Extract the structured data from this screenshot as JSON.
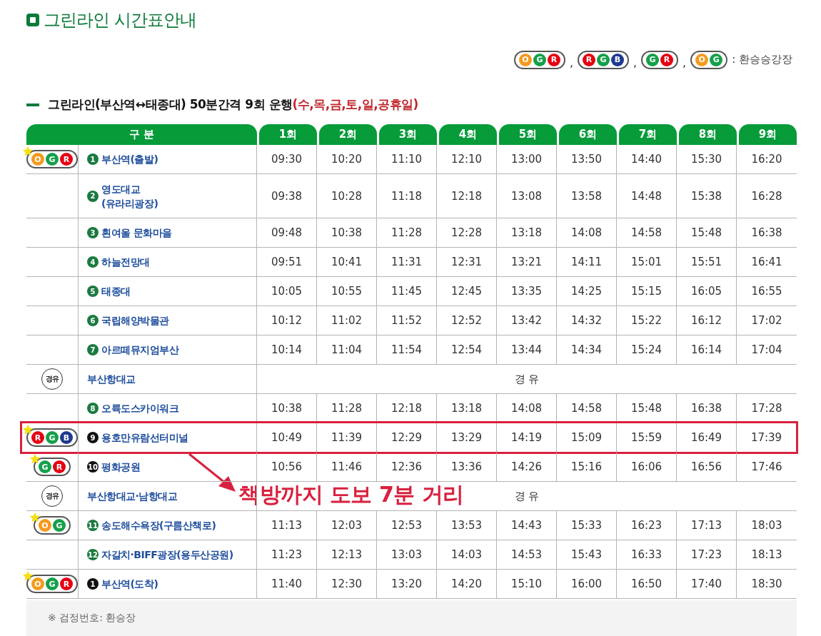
{
  "title": "그린라인 시간표안내",
  "legend": {
    "badges": [
      {
        "dots": [
          {
            "letter": "O",
            "color": "#f39a1e"
          },
          {
            "letter": "G",
            "color": "#14a04a"
          },
          {
            "letter": "R",
            "color": "#e60012"
          }
        ]
      },
      {
        "dots": [
          {
            "letter": "R",
            "color": "#e60012"
          },
          {
            "letter": "G",
            "color": "#14a04a"
          },
          {
            "letter": "B",
            "color": "#1f3a8f"
          }
        ]
      },
      {
        "dots": [
          {
            "letter": "G",
            "color": "#14a04a"
          },
          {
            "letter": "R",
            "color": "#e60012"
          }
        ]
      },
      {
        "dots": [
          {
            "letter": "O",
            "color": "#f39a1e"
          },
          {
            "letter": "G",
            "color": "#14a04a"
          }
        ]
      }
    ],
    "separators": [
      ",",
      ",",
      ","
    ],
    "label": ": 환승승강장"
  },
  "subtitle": {
    "text": "그린라인(부산역↔태종대) 50분간격 9회 운행",
    "days": "(수,목,금,토,일,공휴일)"
  },
  "table": {
    "columns": [
      "구 분",
      "1회",
      "2회",
      "3회",
      "4회",
      "5회",
      "6회",
      "7회",
      "8회",
      "9회"
    ],
    "rows": [
      {
        "kind": "stop",
        "number": "1",
        "color": "#1b7a40",
        "name": "부산역(출발)",
        "transfer": {
          "star": true,
          "dots": [
            {
              "letter": "O",
              "color": "#f39a1e"
            },
            {
              "letter": "G",
              "color": "#14a04a"
            },
            {
              "letter": "R",
              "color": "#e60012"
            }
          ]
        },
        "times": [
          "09:30",
          "10:20",
          "11:10",
          "12:10",
          "13:00",
          "13:50",
          "14:40",
          "15:30",
          "16:20"
        ]
      },
      {
        "kind": "stop",
        "number": "2",
        "color": "#1b7a40",
        "name": "영도대교\n(유라리광장)",
        "times": [
          "09:38",
          "10:28",
          "11:18",
          "12:18",
          "13:08",
          "13:58",
          "14:48",
          "15:38",
          "16:28"
        ]
      },
      {
        "kind": "stop",
        "number": "3",
        "color": "#1b7a40",
        "name": "흰여울 문화마을",
        "times": [
          "09:48",
          "10:38",
          "11:28",
          "12:28",
          "13:18",
          "14:08",
          "14:58",
          "15:48",
          "16:38"
        ]
      },
      {
        "kind": "stop",
        "number": "4",
        "color": "#1b7a40",
        "name": "하늘전망대",
        "times": [
          "09:51",
          "10:41",
          "11:31",
          "12:31",
          "13:21",
          "14:11",
          "15:01",
          "15:51",
          "16:41"
        ]
      },
      {
        "kind": "stop",
        "number": "5",
        "color": "#1b7a40",
        "name": "태종대",
        "times": [
          "10:05",
          "10:55",
          "11:45",
          "12:45",
          "13:35",
          "14:25",
          "15:15",
          "16:05",
          "16:55"
        ]
      },
      {
        "kind": "stop",
        "number": "6",
        "color": "#1b7a40",
        "name": "국립해양박물관",
        "times": [
          "10:12",
          "11:02",
          "11:52",
          "12:52",
          "13:42",
          "14:32",
          "15:22",
          "16:12",
          "17:02"
        ]
      },
      {
        "kind": "stop",
        "number": "7",
        "color": "#1b7a40",
        "name": "아르떼뮤지엄부산",
        "times": [
          "10:14",
          "11:04",
          "11:54",
          "12:54",
          "13:44",
          "14:34",
          "15:24",
          "16:14",
          "17:04"
        ]
      },
      {
        "kind": "via",
        "mark": "경유",
        "name": "부산항대교",
        "note": "경 유"
      },
      {
        "kind": "stop",
        "number": "8",
        "color": "#1b7a40",
        "name": "오륙도스카이워크",
        "times": [
          "10:38",
          "11:28",
          "12:18",
          "13:18",
          "14:08",
          "14:58",
          "15:48",
          "16:38",
          "17:28"
        ]
      },
      {
        "kind": "stop",
        "number": "9",
        "color": "#111111",
        "name": "용호만유람선터미널",
        "highlighted": true,
        "transfer": {
          "star": true,
          "dots": [
            {
              "letter": "R",
              "color": "#e60012"
            },
            {
              "letter": "G",
              "color": "#14a04a"
            },
            {
              "letter": "B",
              "color": "#1f3a8f"
            }
          ]
        },
        "annotation": "책방까지 도보 7분 거리",
        "times": [
          "10:49",
          "11:39",
          "12:29",
          "13:29",
          "14:19",
          "15:09",
          "15:59",
          "16:49",
          "17:39"
        ]
      },
      {
        "kind": "stop",
        "number": "10",
        "color": "#111111",
        "name": "평화공원",
        "transfer": {
          "star": true,
          "dots": [
            {
              "letter": "G",
              "color": "#14a04a"
            },
            {
              "letter": "R",
              "color": "#e60012"
            }
          ]
        },
        "times": [
          "10:56",
          "11:46",
          "12:36",
          "13:36",
          "14:26",
          "15:16",
          "16:06",
          "16:56",
          "17:46"
        ]
      },
      {
        "kind": "via",
        "mark": "경유",
        "name": "부산항대교·남항대교",
        "note": "경 유"
      },
      {
        "kind": "stop",
        "number": "11",
        "color": "#1b7a40",
        "name": "송도해수욕장(구름산책로)",
        "transfer": {
          "star": true,
          "dots": [
            {
              "letter": "O",
              "color": "#f39a1e"
            },
            {
              "letter": "G",
              "color": "#14a04a"
            }
          ]
        },
        "times": [
          "11:13",
          "12:03",
          "12:53",
          "13:53",
          "14:43",
          "15:33",
          "16:23",
          "17:13",
          "18:03"
        ]
      },
      {
        "kind": "stop",
        "number": "12",
        "color": "#1b7a40",
        "name": "자갈치·BIFF광장(용두산공원)",
        "times": [
          "11:23",
          "12:13",
          "13:03",
          "14:03",
          "14:53",
          "15:43",
          "16:33",
          "17:23",
          "18:13"
        ]
      },
      {
        "kind": "stop",
        "number": "1",
        "color": "#111111",
        "name": "부산역(도착)",
        "transfer": {
          "star": true,
          "dots": [
            {
              "letter": "O",
              "color": "#f39a1e"
            },
            {
              "letter": "G",
              "color": "#14a04a"
            },
            {
              "letter": "R",
              "color": "#e60012"
            }
          ]
        },
        "times": [
          "11:40",
          "12:30",
          "13:20",
          "14:20",
          "15:10",
          "16:00",
          "16:50",
          "17:40",
          "18:30"
        ]
      }
    ]
  },
  "footer": "※ 검정번호: 환승장"
}
